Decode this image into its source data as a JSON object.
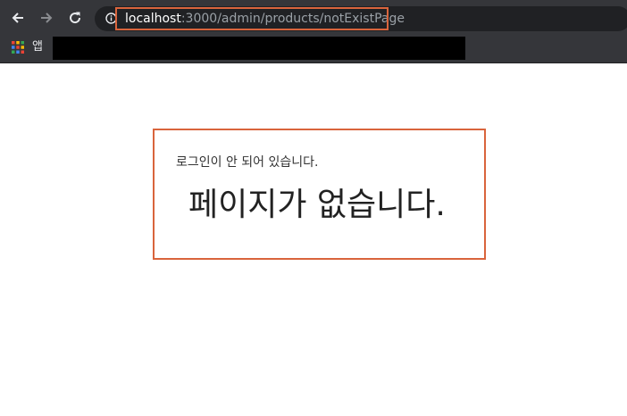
{
  "browser": {
    "url_host": "localhost",
    "url_path": ":3000/admin/products/notExistPage",
    "bookmarks": {
      "apps_label": "앱"
    }
  },
  "icons": {
    "back": "arrow-left-icon",
    "forward": "arrow-right-icon",
    "reload": "reload-icon",
    "site_info": "info-icon",
    "apps": "apps-grid-icon"
  },
  "colors": {
    "toolbar": "#35363a",
    "omnibox": "#202124",
    "highlight": "#d9643c",
    "page_background": "#ffffff"
  },
  "page": {
    "login_message": "로그인이 안 되어 있습니다.",
    "not_found_message": "페이지가 없습니다."
  }
}
